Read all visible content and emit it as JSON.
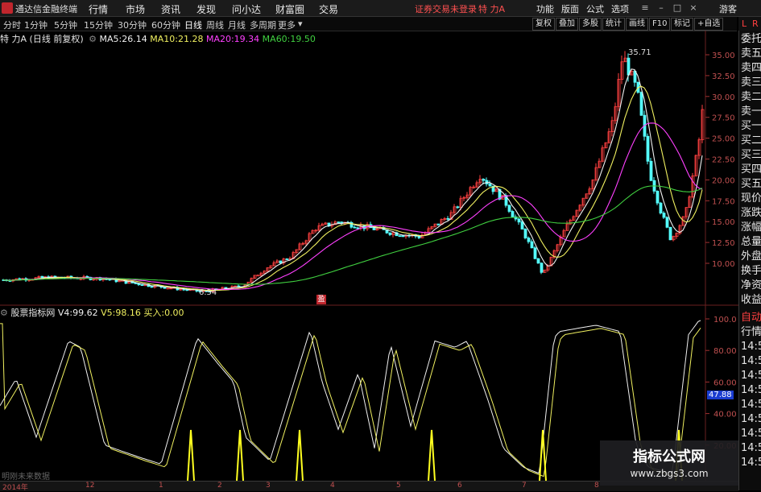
{
  "menubar": {
    "app_title": "通达信金融终端",
    "items": [
      "行情",
      "市场",
      "资讯",
      "发现",
      "问小达",
      "财富圈",
      "交易"
    ],
    "notice": "证券交易未登录",
    "stock_name": "特 力A",
    "right_items": [
      "功能",
      "版面",
      "公式",
      "选项"
    ],
    "guest": "游客"
  },
  "periodbar": {
    "periods": [
      "分时",
      "1分钟",
      "5分钟",
      "15分钟",
      "30分钟",
      "60分钟",
      "日线",
      "周线",
      "月线",
      "多周期",
      "更多"
    ],
    "active": "日线",
    "tools": [
      "复权",
      "叠加",
      "多股",
      "统计",
      "画线",
      "F10",
      "标记",
      "+自选"
    ],
    "lr": [
      "L",
      "R"
    ]
  },
  "infoline": {
    "stock": "特 力A",
    "mode": "(日线 前复权)",
    "ma5_label": "MA5:",
    "ma5": "26.14",
    "ma10_label": "MA10:",
    "ma10": "21.28",
    "ma20_label": "MA20:",
    "ma20": "19.34",
    "ma60_label": "MA60:",
    "ma60": "19.50"
  },
  "price_annotations": {
    "high": "35.71",
    "low": "6.54"
  },
  "price_axis": [
    "35.00",
    "32.50",
    "30.00",
    "27.50",
    "25.00",
    "22.50",
    "20.00",
    "17.50",
    "15.00",
    "12.50",
    "10.00"
  ],
  "indicator": {
    "name": "股票指标网",
    "v4_label": "V4:",
    "v4": "99.62",
    "v5_label": "V5:",
    "v5": "98.16",
    "buy_label": "买入:",
    "buy": "0.00",
    "axis": [
      "100.0",
      "80.00",
      "60.00",
      "40.00",
      "20.00"
    ],
    "current": "47.88",
    "footer": "明刚未来数据"
  },
  "right_panel": {
    "items": [
      "委托",
      "卖五",
      "卖四",
      "卖三",
      "卖二",
      "卖一",
      "买一",
      "买二",
      "买三",
      "买四",
      "买五",
      "现价",
      "涨跌",
      "涨幅",
      "总量",
      "外盘",
      "换手",
      "净资",
      "收益",
      "自动",
      "行情",
      "14:5",
      "14:5",
      "14:5",
      "14:5",
      "14:5",
      "14:5",
      "14:5",
      "14:5",
      "14:5"
    ]
  },
  "date_axis": [
    "2014年",
    "12",
    "1",
    "2",
    "3",
    "4",
    "5",
    "6",
    "7",
    "8"
  ],
  "stamp": "盈",
  "watermark": {
    "title": "指标公式网",
    "url": "www.zbgs3.com"
  },
  "colors": {
    "up": "#ff4040",
    "down": "#54ffff",
    "ma5": "#f0f0f0",
    "ma10": "#f0f060",
    "ma20": "#ff40ff",
    "ma60": "#40d040",
    "accent": "#c0262d"
  }
}
